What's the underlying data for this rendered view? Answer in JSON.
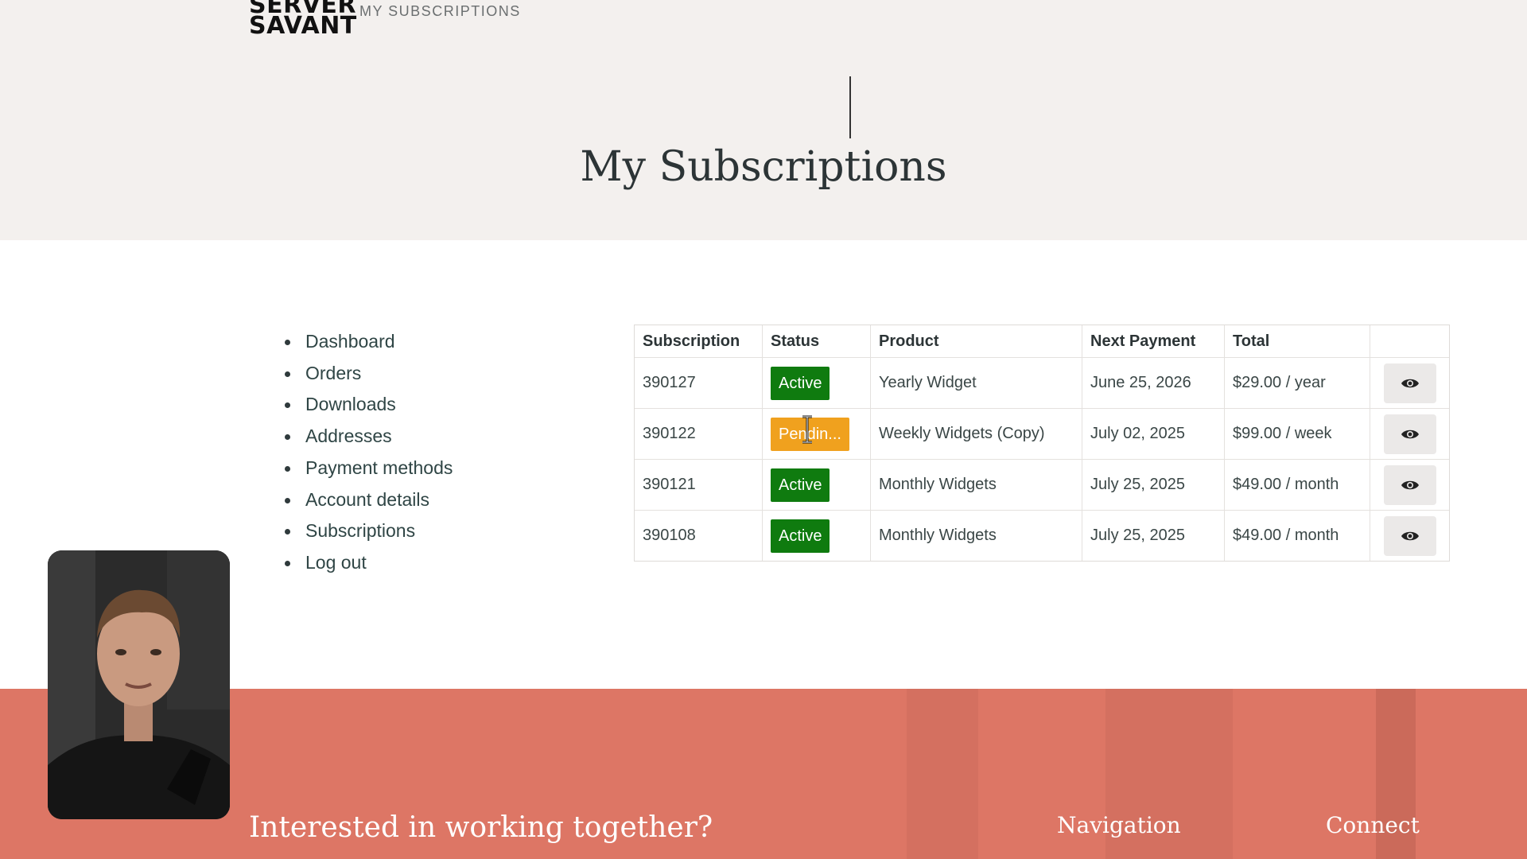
{
  "header": {
    "logo_line1": "SERVER",
    "logo_line2": "SAVANT",
    "breadcrumb": "MY SUBSCRIPTIONS"
  },
  "page": {
    "title": "My Subscriptions"
  },
  "sidebar": {
    "items": [
      {
        "label": "Dashboard"
      },
      {
        "label": "Orders"
      },
      {
        "label": "Downloads"
      },
      {
        "label": "Addresses"
      },
      {
        "label": "Payment methods"
      },
      {
        "label": "Account details"
      },
      {
        "label": "Subscriptions"
      },
      {
        "label": "Log out"
      }
    ]
  },
  "subscriptions": {
    "columns": [
      "Subscription",
      "Status",
      "Product",
      "Next Payment",
      "Total",
      ""
    ],
    "rows": [
      {
        "id": "390127",
        "status": "Active",
        "status_color": "#0f7b0f",
        "product": "Yearly Widget",
        "next_payment": "June 25, 2026",
        "total": "$29.00 / year"
      },
      {
        "id": "390122",
        "status": "Pendin...",
        "status_color": "#f0a11e",
        "product": "Weekly Widgets (Copy)",
        "next_payment": "July 02, 2025",
        "total": "$99.00 / week"
      },
      {
        "id": "390121",
        "status": "Active",
        "status_color": "#0f7b0f",
        "product": "Monthly Widgets",
        "next_payment": "July 25, 2025",
        "total": "$49.00 / month"
      },
      {
        "id": "390108",
        "status": "Active",
        "status_color": "#0f7b0f",
        "product": "Monthly Widgets",
        "next_payment": "July 25, 2025",
        "total": "$49.00 / month"
      }
    ],
    "action_icon": "eye-icon"
  },
  "footer": {
    "heading": "Interested in working together?",
    "nav_title": "Navigation",
    "connect_title": "Connect",
    "background_color": "#dd7665"
  }
}
